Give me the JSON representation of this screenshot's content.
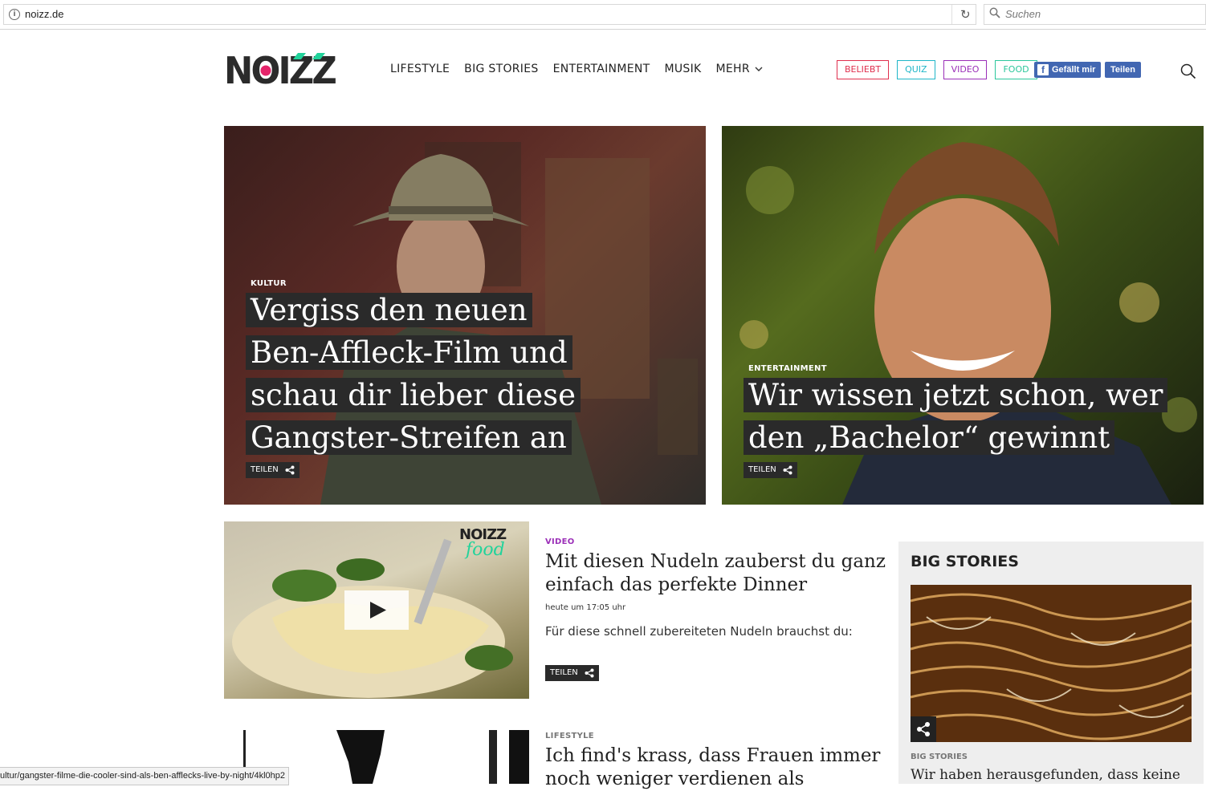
{
  "browser": {
    "url": "noizz.de",
    "search_placeholder": "Suchen"
  },
  "site": {
    "logo_text": "NOIZZ",
    "nav": [
      "LIFESTYLE",
      "BIG STORIES",
      "ENTERTAINMENT",
      "MUSIK",
      "MEHR"
    ],
    "tags": [
      {
        "label": "BELIEBT",
        "color": "#e0304e"
      },
      {
        "label": "QUIZ",
        "color": "#1fb6c8"
      },
      {
        "label": "VIDEO",
        "color": "#9b2fb8"
      },
      {
        "label": "FOOD",
        "color": "#2cc79c"
      }
    ],
    "fb_like_label": "Gefällt mir",
    "fb_share_label": "Teilen"
  },
  "hero": [
    {
      "category": "KULTUR",
      "title_lines": [
        "Vergiss den neuen",
        "Ben-Affleck-Film und",
        "schau dir lieber diese",
        "Gangster-Streifen an"
      ],
      "share_label": "TEILEN"
    },
    {
      "category": "ENTERTAINMENT",
      "title_lines": [
        "Wir wissen jetzt schon, wer",
        "den „Bachelor“ gewinnt"
      ],
      "share_label": "TEILEN"
    }
  ],
  "articles": [
    {
      "category": "VIDEO",
      "category_color": "#9b2fb8",
      "title": "Mit diesen Nudeln zauberst du ganz einfach das perfekte Dinner",
      "date": "heute um 17:05 uhr",
      "teaser": "Für diese schnell zubereiteten Nudeln brauchst du:",
      "share_label": "TEILEN",
      "thumb_brand": "NOIZZ",
      "thumb_sub": "food"
    },
    {
      "category": "LIFESTYLE",
      "category_color": "#777777",
      "title": "Ich find's krass, dass Frauen immer noch weniger verdienen als"
    }
  ],
  "sidebar": {
    "title": "BIG STORIES",
    "item_category": "BIG STORIES",
    "item_title": "Wir haben herausgefunden, dass keine"
  },
  "status_bar": "ultur/gangster-filme-die-cooler-sind-als-ben-afflecks-live-by-night/4kl0hp2",
  "colors": {
    "accent_pink": "#e5246a",
    "accent_green": "#22d39b",
    "dark_label_bg": "#2a2a2a",
    "facebook": "#4267b2"
  }
}
